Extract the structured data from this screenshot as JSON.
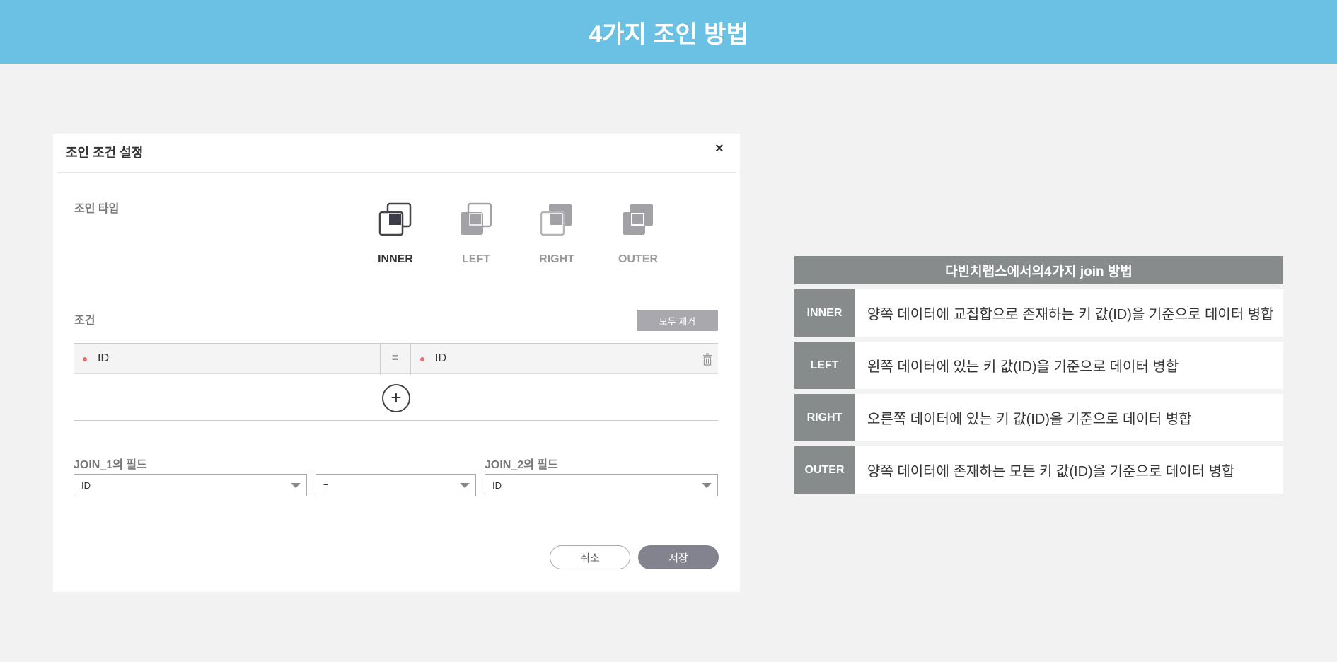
{
  "page_title": "4가지 조인 방법",
  "dialog": {
    "title": "조인 조건 설정",
    "close_label": "×",
    "join_type_label": "조인 타입",
    "join_types": [
      {
        "label": "INNER",
        "active": true
      },
      {
        "label": "LEFT",
        "active": false
      },
      {
        "label": "RIGHT",
        "active": false
      },
      {
        "label": "OUTER",
        "active": false
      }
    ],
    "condition_label": "조건",
    "clear_all_label": "모두 제거",
    "condition": {
      "left": "ID",
      "operator": "=",
      "right": "ID"
    },
    "add_label": "+",
    "join1_field_label": "JOIN_1의 필드",
    "join2_field_label": "JOIN_2의 필드",
    "join1_value": "ID",
    "operator_value": "=",
    "join2_value": "ID",
    "cancel_label": "취소",
    "save_label": "저장"
  },
  "table": {
    "title": "다빈치랩스에서의4가지 join 방법",
    "rows": [
      {
        "type": "INNER",
        "desc": "양쪽 데이터에 교집합으로 존재하는 키 값(ID)을 기준으로 데이터 병합"
      },
      {
        "type": "LEFT",
        "desc": "왼쪽 데이터에 있는 키 값(ID)을 기준으로 데이터 병합"
      },
      {
        "type": "RIGHT",
        "desc": "오른쪽 데이터에 있는 키 값(ID)을 기준으로 데이터 병합"
      },
      {
        "type": "OUTER",
        "desc": "양쪽 데이터에 존재하는 모든 키 값(ID)을 기준으로 데이터 병합"
      }
    ]
  }
}
